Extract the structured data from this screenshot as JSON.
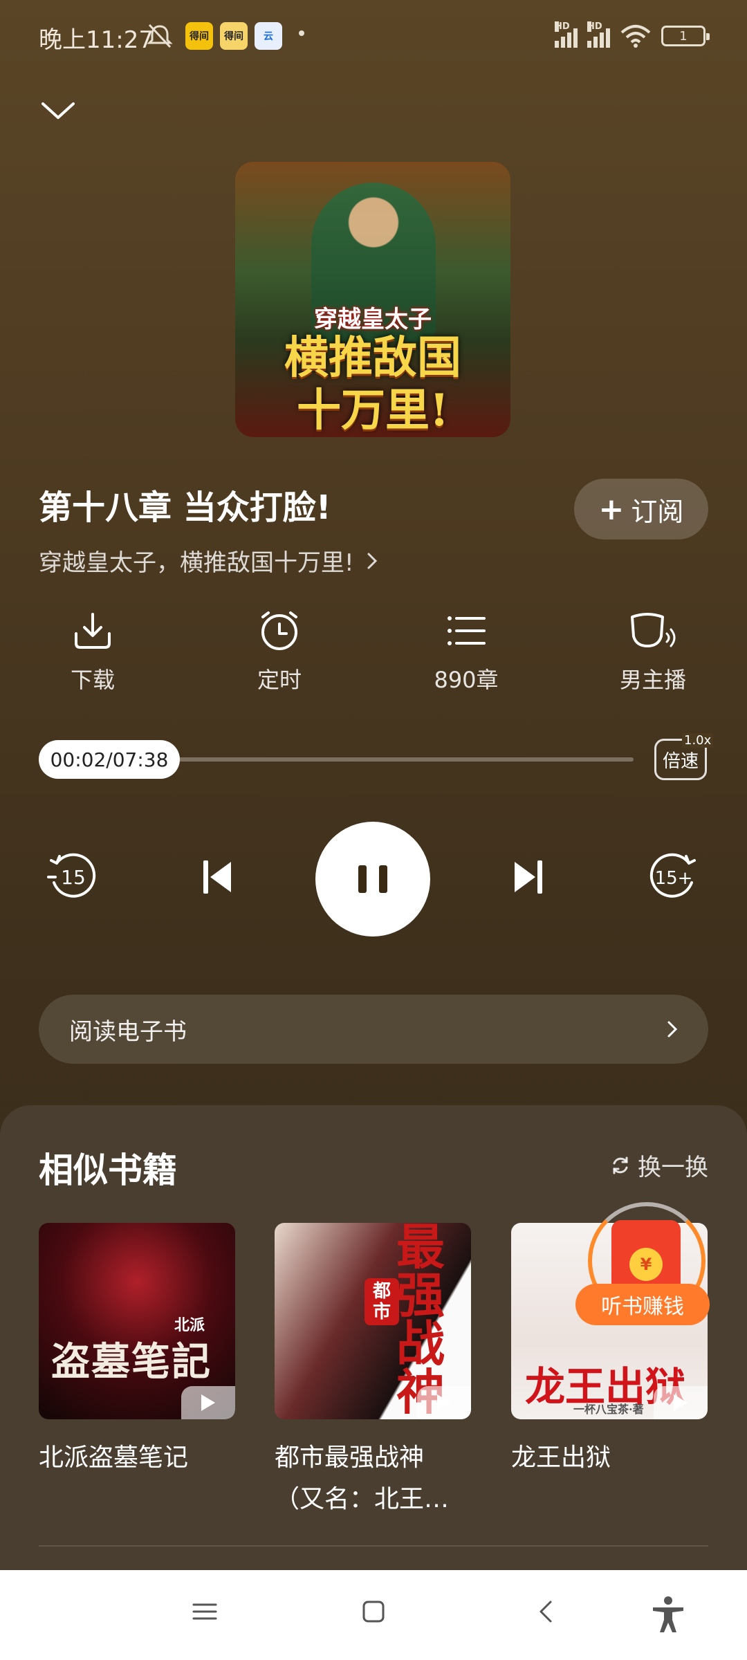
{
  "status_bar": {
    "time": "晚上11:27",
    "apps": [
      {
        "label": "得间",
        "color": "#f4c20d"
      },
      {
        "label": "得间",
        "color": "#f7d46a"
      },
      {
        "label": "云",
        "color": "#e8f0ff"
      }
    ],
    "signal_label": "HD",
    "battery": "1"
  },
  "player": {
    "cover": {
      "subtitle": "穿越皇太子",
      "title_line1": "横推敌国",
      "title_line2": "十万里!"
    },
    "chapter_title": "第十八章  当众打脸!",
    "subscribe_label": "订阅",
    "book_name": "穿越皇太子，横推敌国十万里!",
    "actions": [
      {
        "label": "下载",
        "icon": "download-icon"
      },
      {
        "label": "定时",
        "icon": "alarm-clock-icon"
      },
      {
        "label": "890章",
        "icon": "list-icon"
      },
      {
        "label": "男主播",
        "icon": "narrator-icon"
      }
    ],
    "progress": {
      "elapsed": "00:02",
      "total": "07:38",
      "display": "00:02/07:38",
      "fraction": 0.004
    },
    "speed": {
      "label": "倍速",
      "value": "1.0x"
    },
    "rewind_label": "15",
    "forward_label": "15+",
    "ebook_label": "阅读电子书"
  },
  "similar": {
    "title": "相似书籍",
    "refresh_label": "换一换",
    "books": [
      {
        "title": "北派盗墓笔记",
        "cover_text": "盗墓笔記",
        "cover_tag": "北派"
      },
      {
        "title": "都市最强战神（又名：北王…",
        "cover_text": "最强战神",
        "cover_tag": "都市"
      },
      {
        "title": "龙王出狱",
        "cover_text": "龙王出狱",
        "cover_tag": "一杯八宝茶·著"
      }
    ],
    "promo_label": "听书赚钱",
    "promo_coin": "¥"
  },
  "colors": {
    "accent": "#ff7a2a",
    "background": "#4a3820",
    "sheet": "#4a3e30"
  }
}
